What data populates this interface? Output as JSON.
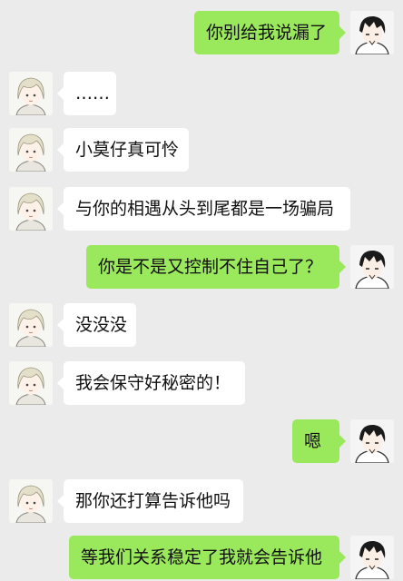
{
  "messages": [
    {
      "side": "right",
      "text": "你别给我说漏了",
      "avatar": "boy-avatar"
    },
    {
      "side": "left",
      "text": "……",
      "avatar": "girl-avatar"
    },
    {
      "side": "left",
      "text": "小莫仔真可怜",
      "avatar": "girl-avatar"
    },
    {
      "side": "left",
      "text": "与你的相遇从头到尾都是一场骗局",
      "avatar": "girl-avatar"
    },
    {
      "side": "right",
      "text": "你是不是又控制不住自己了？",
      "avatar": "boy-avatar"
    },
    {
      "side": "left",
      "text": "没没没",
      "avatar": "girl-avatar"
    },
    {
      "side": "left",
      "text": "我会保守好秘密的！",
      "avatar": "girl-avatar"
    },
    {
      "side": "right",
      "text": "嗯",
      "avatar": "boy-avatar"
    },
    {
      "side": "left",
      "text": "那你还打算告诉他吗",
      "avatar": "girl-avatar"
    },
    {
      "side": "right",
      "text": "等我们关系稳定了我就会告诉他",
      "avatar": "boy-avatar"
    }
  ],
  "colors": {
    "background": "#ebebeb",
    "incoming_bubble": "#ffffff",
    "outgoing_bubble": "#9ae85b"
  }
}
